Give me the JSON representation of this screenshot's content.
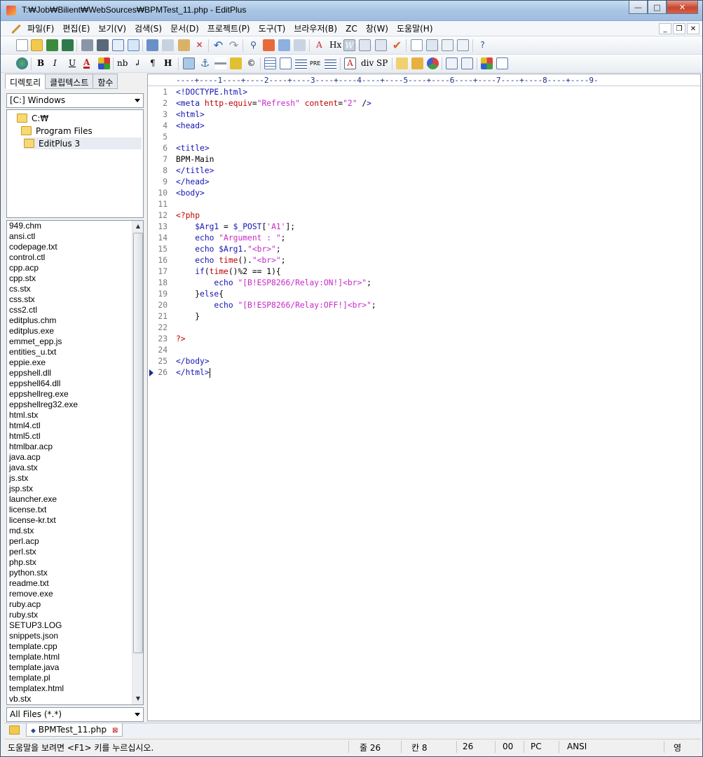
{
  "window": {
    "title": "T:₩Job₩Bilient₩WebSources₩BPMTest_11.php - EditPlus",
    "min": "—",
    "max": "□",
    "close": "✕"
  },
  "menu": [
    "파일(F)",
    "편집(E)",
    "보기(V)",
    "검색(S)",
    "문서(D)",
    "프로젝트(P)",
    "도구(T)",
    "브라우저(B)",
    "ZC",
    "창(W)",
    "도움말(H)"
  ],
  "mdi": {
    "min": "_",
    "restore": "❐",
    "close": "✕"
  },
  "toolbar2_text": {
    "bold": "B",
    "italic": "I",
    "underline": "U",
    "font_color": "A",
    "nbsp": "nb",
    "br": "↲",
    "para": "¶",
    "heading": "H",
    "pre": "PRE",
    "div": "div",
    "sp": "SP",
    "hx": "Hx"
  },
  "left": {
    "tabs": [
      "디렉토리",
      "클립텍스트",
      "함수"
    ],
    "drive": "[C:] Windows",
    "folders": [
      "C:₩",
      "Program Files",
      "EditPlus 3"
    ],
    "files": [
      "949.chm",
      "ansi.ctl",
      "codepage.txt",
      "control.ctl",
      "cpp.acp",
      "cpp.stx",
      "cs.stx",
      "css.stx",
      "css2.ctl",
      "editplus.chm",
      "editplus.exe",
      "emmet_epp.js",
      "entities_u.txt",
      "eppie.exe",
      "eppshell.dll",
      "eppshell64.dll",
      "eppshellreg.exe",
      "eppshellreg32.exe",
      "html.stx",
      "html4.ctl",
      "html5.ctl",
      "htmlbar.acp",
      "java.acp",
      "java.stx",
      "js.stx",
      "jsp.stx",
      "launcher.exe",
      "license.txt",
      "license-kr.txt",
      "md.stx",
      "perl.acp",
      "perl.stx",
      "php.stx",
      "python.stx",
      "readme.txt",
      "remove.exe",
      "ruby.acp",
      "ruby.stx",
      "SETUP3.LOG",
      "snippets.json",
      "template.cpp",
      "template.html",
      "template.java",
      "template.pl",
      "templatex.html",
      "vb.stx"
    ],
    "filter": "All Files (*.*)"
  },
  "editor": {
    "ruler": "----+----1----+----2----+----3----+----4----+----5----+----6----+----7----+----8----+----9-",
    "lines": [
      {
        "n": "1",
        "t": "<!DOCTYPE.html>"
      },
      {
        "n": "2",
        "t": "<meta http-equiv=\"Refresh\" content=\"2\" />"
      },
      {
        "n": "3",
        "t": "<html>"
      },
      {
        "n": "4",
        "t": "<head>"
      },
      {
        "n": "5",
        "t": ""
      },
      {
        "n": "6",
        "t": "<title>"
      },
      {
        "n": "7",
        "t": "BPM-Main"
      },
      {
        "n": "8",
        "t": "</title>"
      },
      {
        "n": "9",
        "t": "</head>"
      },
      {
        "n": "10",
        "t": "<body>"
      },
      {
        "n": "11",
        "t": ""
      },
      {
        "n": "12",
        "t": "<?php"
      },
      {
        "n": "13",
        "t": "    $Arg1 = $_POST['A1'];"
      },
      {
        "n": "14",
        "t": "    echo \"Argument : \";"
      },
      {
        "n": "15",
        "t": "    echo $Arg1.\"<br>\";"
      },
      {
        "n": "16",
        "t": "    echo time().\"<br>\";"
      },
      {
        "n": "17",
        "t": "    if(time()%2 == 1){"
      },
      {
        "n": "18",
        "t": "        echo \"[B!ESP8266/Relay:ON!]<br>\";"
      },
      {
        "n": "19",
        "t": "    }else{"
      },
      {
        "n": "20",
        "t": "        echo \"[B!ESP8266/Relay:OFF!]<br>\";"
      },
      {
        "n": "21",
        "t": "    }"
      },
      {
        "n": "22",
        "t": ""
      },
      {
        "n": "23",
        "t": "?>"
      },
      {
        "n": "24",
        "t": ""
      },
      {
        "n": "25",
        "t": "</body>"
      },
      {
        "n": "26",
        "t": "</html>"
      }
    ]
  },
  "doc_tab": "BPMTest_11.php",
  "status": {
    "help": "도움말을 보려면 <F1> 키를 누르십시오.",
    "line": "줄 26",
    "col": "칸 8",
    "total": "26",
    "sel": "00",
    "mode": "PC",
    "encoding": "ANSI",
    "ime": "영"
  }
}
